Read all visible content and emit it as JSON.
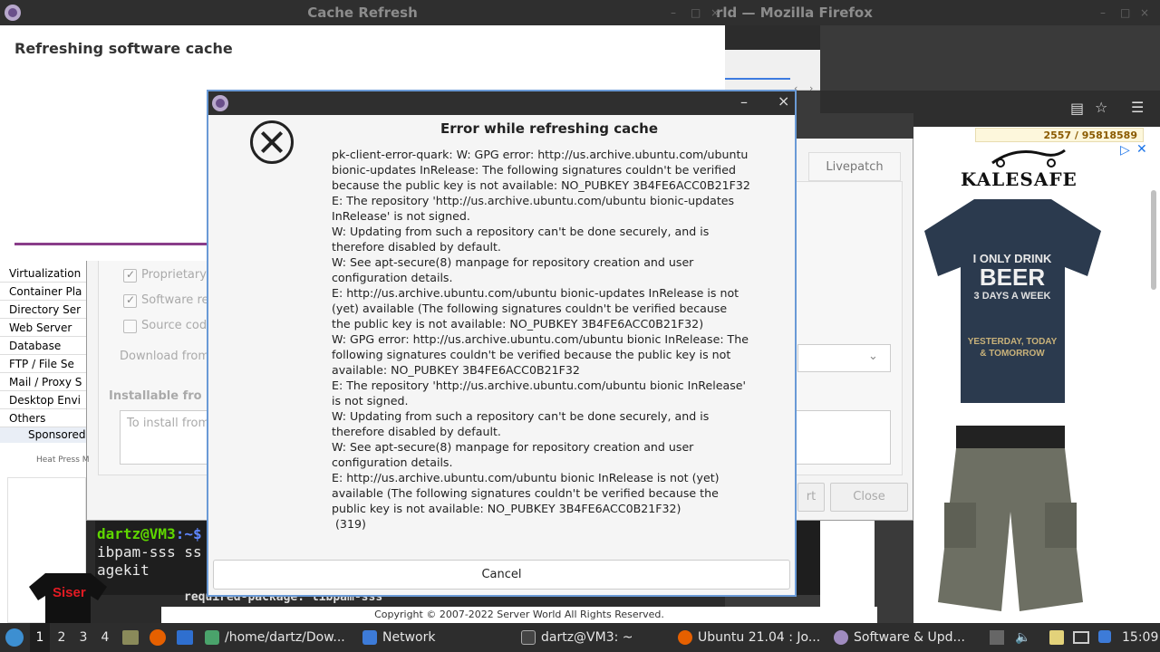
{
  "cache_window": {
    "title": "Cache Refresh",
    "heading": "Refreshing software cache"
  },
  "firefox": {
    "title_fragment": "rld — Mozilla Firefox",
    "counter": "2557 / 95818589",
    "ad_brand": "KALESAFE"
  },
  "software_updates": {
    "tab_livepatch": "Livepatch",
    "check_proprietary": "Proprietary",
    "check_software": "Software re",
    "check_source": "Source cod",
    "download_from": "Download from",
    "installable_from": "Installable fro",
    "to_install": "To install from",
    "close_button": "Close",
    "revert_fragment": "rt"
  },
  "sidebar_nav": {
    "items": [
      "Virtualization",
      "Container Pla",
      "Directory Ser",
      "Web Server",
      "Database",
      "FTP / File Se",
      "Mail / Proxy S",
      "Desktop Envi",
      "Others"
    ],
    "sponsored": "Sponsored",
    "heat_press": "Heat Press M"
  },
  "terminal": {
    "prompt_user": "dartz@VM3",
    "prompt_path": ":~$",
    "line2": "ibpam-sss ss",
    "line3": "agekit",
    "bottom_line": "required-package: libpam-sss",
    "ad_text": "Siser"
  },
  "copyright": "Copyright © 2007-2022 Server World All Rights Reserved.",
  "dialog": {
    "title": "Error while refreshing cache",
    "message": "pk-client-error-quark: W: GPG error: http://us.archive.ubuntu.com/ubuntu\nbionic-updates InRelease: The following signatures couldn't be verified\nbecause the public key is not available: NO_PUBKEY 3B4FE6ACC0B21F32\nE: The repository 'http://us.archive.ubuntu.com/ubuntu bionic-updates\nInRelease' is not signed.\nW: Updating from such a repository can't be done securely, and is\ntherefore disabled by default.\nW: See apt-secure(8) manpage for repository creation and user\nconfiguration details.\nE: http://us.archive.ubuntu.com/ubuntu bionic-updates InRelease is not\n(yet) available (The following signatures couldn't be verified because\nthe public key is not available: NO_PUBKEY 3B4FE6ACC0B21F32)\nW: GPG error: http://us.archive.ubuntu.com/ubuntu bionic InRelease: The\nfollowing signatures couldn't be verified because the public key is not\navailable: NO_PUBKEY 3B4FE6ACC0B21F32\nE: The repository 'http://us.archive.ubuntu.com/ubuntu bionic InRelease'\nis not signed.\nW: Updating from such a repository can't be done securely, and is\ntherefore disabled by default.\nW: See apt-secure(8) manpage for repository creation and user\nconfiguration details.\nE: http://us.archive.ubuntu.com/ubuntu bionic InRelease is not (yet)\navailable (The following signatures couldn't be verified because the\npublic key is not available: NO_PUBKEY 3B4FE6ACC0B21F32)\n (319)",
    "cancel_label": "Cancel",
    "minimize_glyph": "–",
    "close_glyph": "×"
  },
  "taskbar": {
    "workspaces": [
      "1",
      "2",
      "3",
      "4"
    ],
    "active_workspace": "1",
    "tasks": [
      {
        "label": "/home/dartz/Dow...",
        "icon": "image-viewer-icon"
      },
      {
        "label": "Network",
        "icon": "folder-icon"
      },
      {
        "label": "dartz@VM3: ~",
        "icon": "terminal-icon"
      },
      {
        "label": "Ubuntu 21.04 : Jo...",
        "icon": "firefox-icon"
      },
      {
        "label": "Software & Upd...",
        "icon": "software-updates-icon"
      }
    ],
    "clock": "15:09"
  }
}
